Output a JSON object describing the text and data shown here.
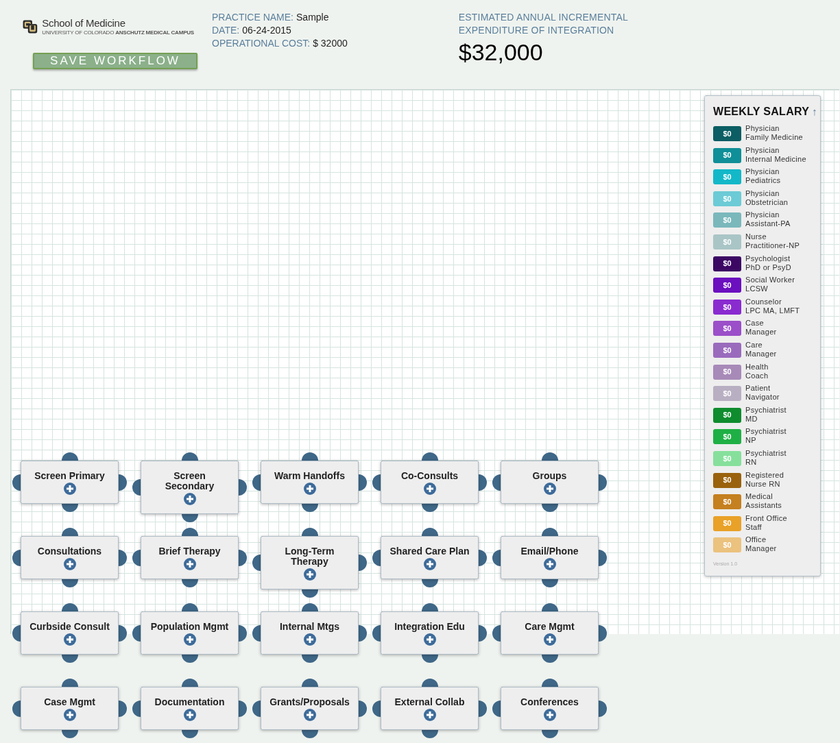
{
  "header": {
    "logo": {
      "title": "School of Medicine",
      "subtitle_regular": "UNIVERSITY OF COLORADO",
      "subtitle_bold": "ANSCHUTZ MEDICAL CAMPUS"
    },
    "save_button": "SAVE WORKFLOW",
    "practice_info": [
      {
        "label": "PRACTICE NAME:",
        "value": "Sample"
      },
      {
        "label": "DATE:",
        "value": "06-24-2015"
      },
      {
        "label": "OPERATIONAL COST:",
        "value": "$ 32000"
      }
    ],
    "estimate": {
      "label_lines": [
        "ESTIMATED ANNUAL INCREMENTAL",
        "EXPENDITURE OF INTEGRATION"
      ],
      "amount": "$32,000"
    }
  },
  "activities": [
    {
      "lines": [
        "Screen Primary"
      ]
    },
    {
      "lines": [
        "Screen",
        "Secondary"
      ]
    },
    {
      "lines": [
        "Warm Handoffs"
      ]
    },
    {
      "lines": [
        "Co-Consults"
      ]
    },
    {
      "lines": [
        "Groups"
      ]
    },
    {
      "lines": [
        "Consultations"
      ]
    },
    {
      "lines": [
        "Brief Therapy"
      ]
    },
    {
      "lines": [
        "Long-Term",
        "Therapy"
      ]
    },
    {
      "lines": [
        "Shared Care Plan"
      ]
    },
    {
      "lines": [
        "Email/Phone"
      ]
    },
    {
      "lines": [
        "Curbside Consult"
      ]
    },
    {
      "lines": [
        "Population Mgmt"
      ]
    },
    {
      "lines": [
        "Internal Mtgs"
      ]
    },
    {
      "lines": [
        "Integration Edu"
      ]
    },
    {
      "lines": [
        "Care Mgmt"
      ]
    },
    {
      "lines": [
        "Case Mgmt"
      ]
    },
    {
      "lines": [
        "Documentation"
      ]
    },
    {
      "lines": [
        "Grants/Proposals"
      ]
    },
    {
      "lines": [
        "External Collab"
      ]
    },
    {
      "lines": [
        "Conferences"
      ]
    }
  ],
  "legend": {
    "title": "WEEKLY SALARY",
    "sort_arrow": "↑",
    "items": [
      {
        "amount": "$0",
        "line1": "Physician",
        "line2": "Family Medicine",
        "color": "#0b5e63"
      },
      {
        "amount": "$0",
        "line1": "Physician",
        "line2": "Internal Medicine",
        "color": "#0f8f98"
      },
      {
        "amount": "$0",
        "line1": "Physician",
        "line2": "Pediatrics",
        "color": "#13b8c8"
      },
      {
        "amount": "$0",
        "line1": "Physician",
        "line2": "Obstetrician",
        "color": "#6ccbd6"
      },
      {
        "amount": "$0",
        "line1": "Physician",
        "line2": "Assistant-PA",
        "color": "#7ab8bc"
      },
      {
        "amount": "$0",
        "line1": "Nurse",
        "line2": "Practitioner-NP",
        "color": "#aac5c6"
      },
      {
        "amount": "$0",
        "line1": "Psychologist",
        "line2": "PhD or PsyD",
        "color": "#3b0763"
      },
      {
        "amount": "$0",
        "line1": "Social Worker",
        "line2": "LCSW",
        "color": "#6b0fbf"
      },
      {
        "amount": "$0",
        "line1": "Counselor",
        "line2": "LPC MA, LMFT",
        "color": "#8a2bd0"
      },
      {
        "amount": "$0",
        "line1": "Case",
        "line2": "Manager",
        "color": "#9b4fc9"
      },
      {
        "amount": "$0",
        "line1": "Care",
        "line2": "Manager",
        "color": "#9a6bbd"
      },
      {
        "amount": "$0",
        "line1": "Health",
        "line2": "Coach",
        "color": "#a78ab8"
      },
      {
        "amount": "$0",
        "line1": "Patient",
        "line2": "Navigator",
        "color": "#b9afc2"
      },
      {
        "amount": "$0",
        "line1": "Psychiatrist",
        "line2": "MD",
        "color": "#0f8c2e"
      },
      {
        "amount": "$0",
        "line1": "Psychiatrist",
        "line2": "NP",
        "color": "#1fb045"
      },
      {
        "amount": "$0",
        "line1": "Psychiatrist",
        "line2": "RN",
        "color": "#86e09c"
      },
      {
        "amount": "$0",
        "line1": "Registered",
        "line2": "Nurse RN",
        "color": "#9a620d"
      },
      {
        "amount": "$0",
        "line1": "Medical",
        "line2": "Assistants",
        "color": "#c5801f"
      },
      {
        "amount": "$0",
        "line1": "Front Office",
        "line2": "Staff",
        "color": "#e9a127"
      },
      {
        "amount": "$0",
        "line1": "Office",
        "line2": "Manager",
        "color": "#ebc27e"
      }
    ],
    "version": "Version 1.0"
  }
}
